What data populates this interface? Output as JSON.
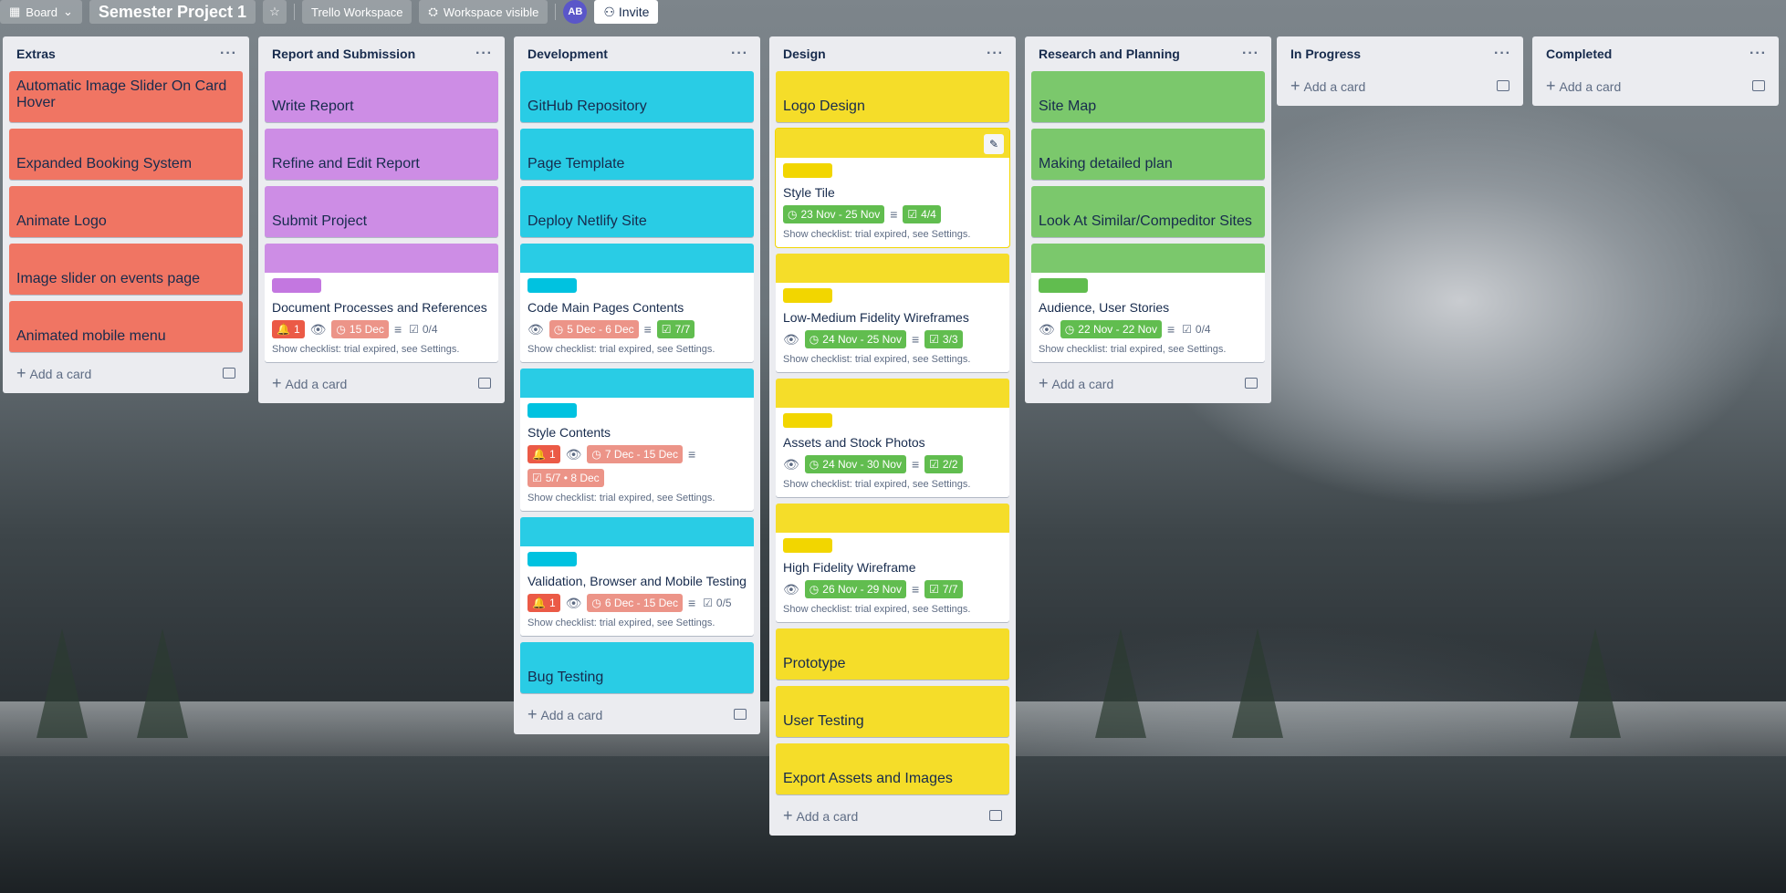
{
  "topbar": {
    "board_view": "Board",
    "title": "Semester Project 1",
    "workspace": "Trello Workspace",
    "visibility": "Workspace visible",
    "avatar_initials": "AB",
    "invite": "Invite"
  },
  "colors": {
    "red": "#f07563",
    "purple": "#cd8de5",
    "cyan": "#29cce5",
    "yellow": "#f5dd29",
    "green": "#7bc86c",
    "label_purple": "#c377e0",
    "label_cyan": "#00c2e0",
    "label_yellow": "#f2d600",
    "label_green": "#61bd4f"
  },
  "common": {
    "add_card": "Add a card",
    "checklist_note": "Show checklist: trial expired, see Settings."
  },
  "lists": {
    "extras": {
      "title": "Extras",
      "cards": [
        "Automatic Image Slider On Card Hover",
        "Expanded Booking System",
        "Animate Logo",
        "Image slider on events page",
        "Animated mobile menu"
      ]
    },
    "report": {
      "title": "Report and Submission",
      "cards": [
        "Write Report",
        "Refine and Edit Report",
        "Submit Project"
      ],
      "detail": {
        "title": "Document Processes and References",
        "notif": "1",
        "date": "15 Dec",
        "checklist": "0/4"
      }
    },
    "development": {
      "title": "Development",
      "cards": [
        "GitHub Repository",
        "Page Template",
        "Deploy Netlify Site"
      ],
      "detail1": {
        "title": "Code Main Pages Contents",
        "date": "5 Dec - 6 Dec",
        "checklist": "7/7"
      },
      "detail2": {
        "title": "Style Contents",
        "notif": "1",
        "date": "7 Dec - 15 Dec",
        "checklist": "5/7 • 8 Dec"
      },
      "detail3": {
        "title": "Validation, Browser and Mobile Testing",
        "notif": "1",
        "date": "6 Dec - 15 Dec",
        "checklist": "0/5"
      },
      "last": "Bug Testing"
    },
    "design": {
      "title": "Design",
      "cards": [
        "Logo Design"
      ],
      "detail1": {
        "title": "Style Tile",
        "date": "23 Nov - 25 Nov",
        "checklist": "4/4"
      },
      "detail2": {
        "title": "Low-Medium Fidelity Wireframes",
        "date": "24 Nov - 25 Nov",
        "checklist": "3/3"
      },
      "detail3": {
        "title": "Assets and Stock Photos",
        "date": "24 Nov - 30 Nov",
        "checklist": "2/2"
      },
      "detail4": {
        "title": "High Fidelity Wireframe",
        "date": "26 Nov - 29 Nov",
        "checklist": "7/7"
      },
      "tail": [
        "Prototype",
        "User Testing",
        "Export Assets and Images"
      ]
    },
    "research": {
      "title": "Research and Planning",
      "cards": [
        "Site Map",
        "Making detailed plan",
        "Look At Similar/Compeditor Sites"
      ],
      "detail": {
        "title": "Audience, User Stories",
        "date": "22 Nov - 22 Nov",
        "checklist": "0/4"
      }
    },
    "inprogress": {
      "title": "In Progress"
    },
    "completed": {
      "title": "Completed"
    }
  },
  "icons": [
    "board-icon",
    "chevron-down-icon",
    "star-icon",
    "people-icon",
    "invite-icon",
    "more-icon",
    "plus-icon",
    "template-icon",
    "bell-icon",
    "eye-icon",
    "clock-icon",
    "description-icon",
    "checklist-icon",
    "pencil-icon"
  ]
}
